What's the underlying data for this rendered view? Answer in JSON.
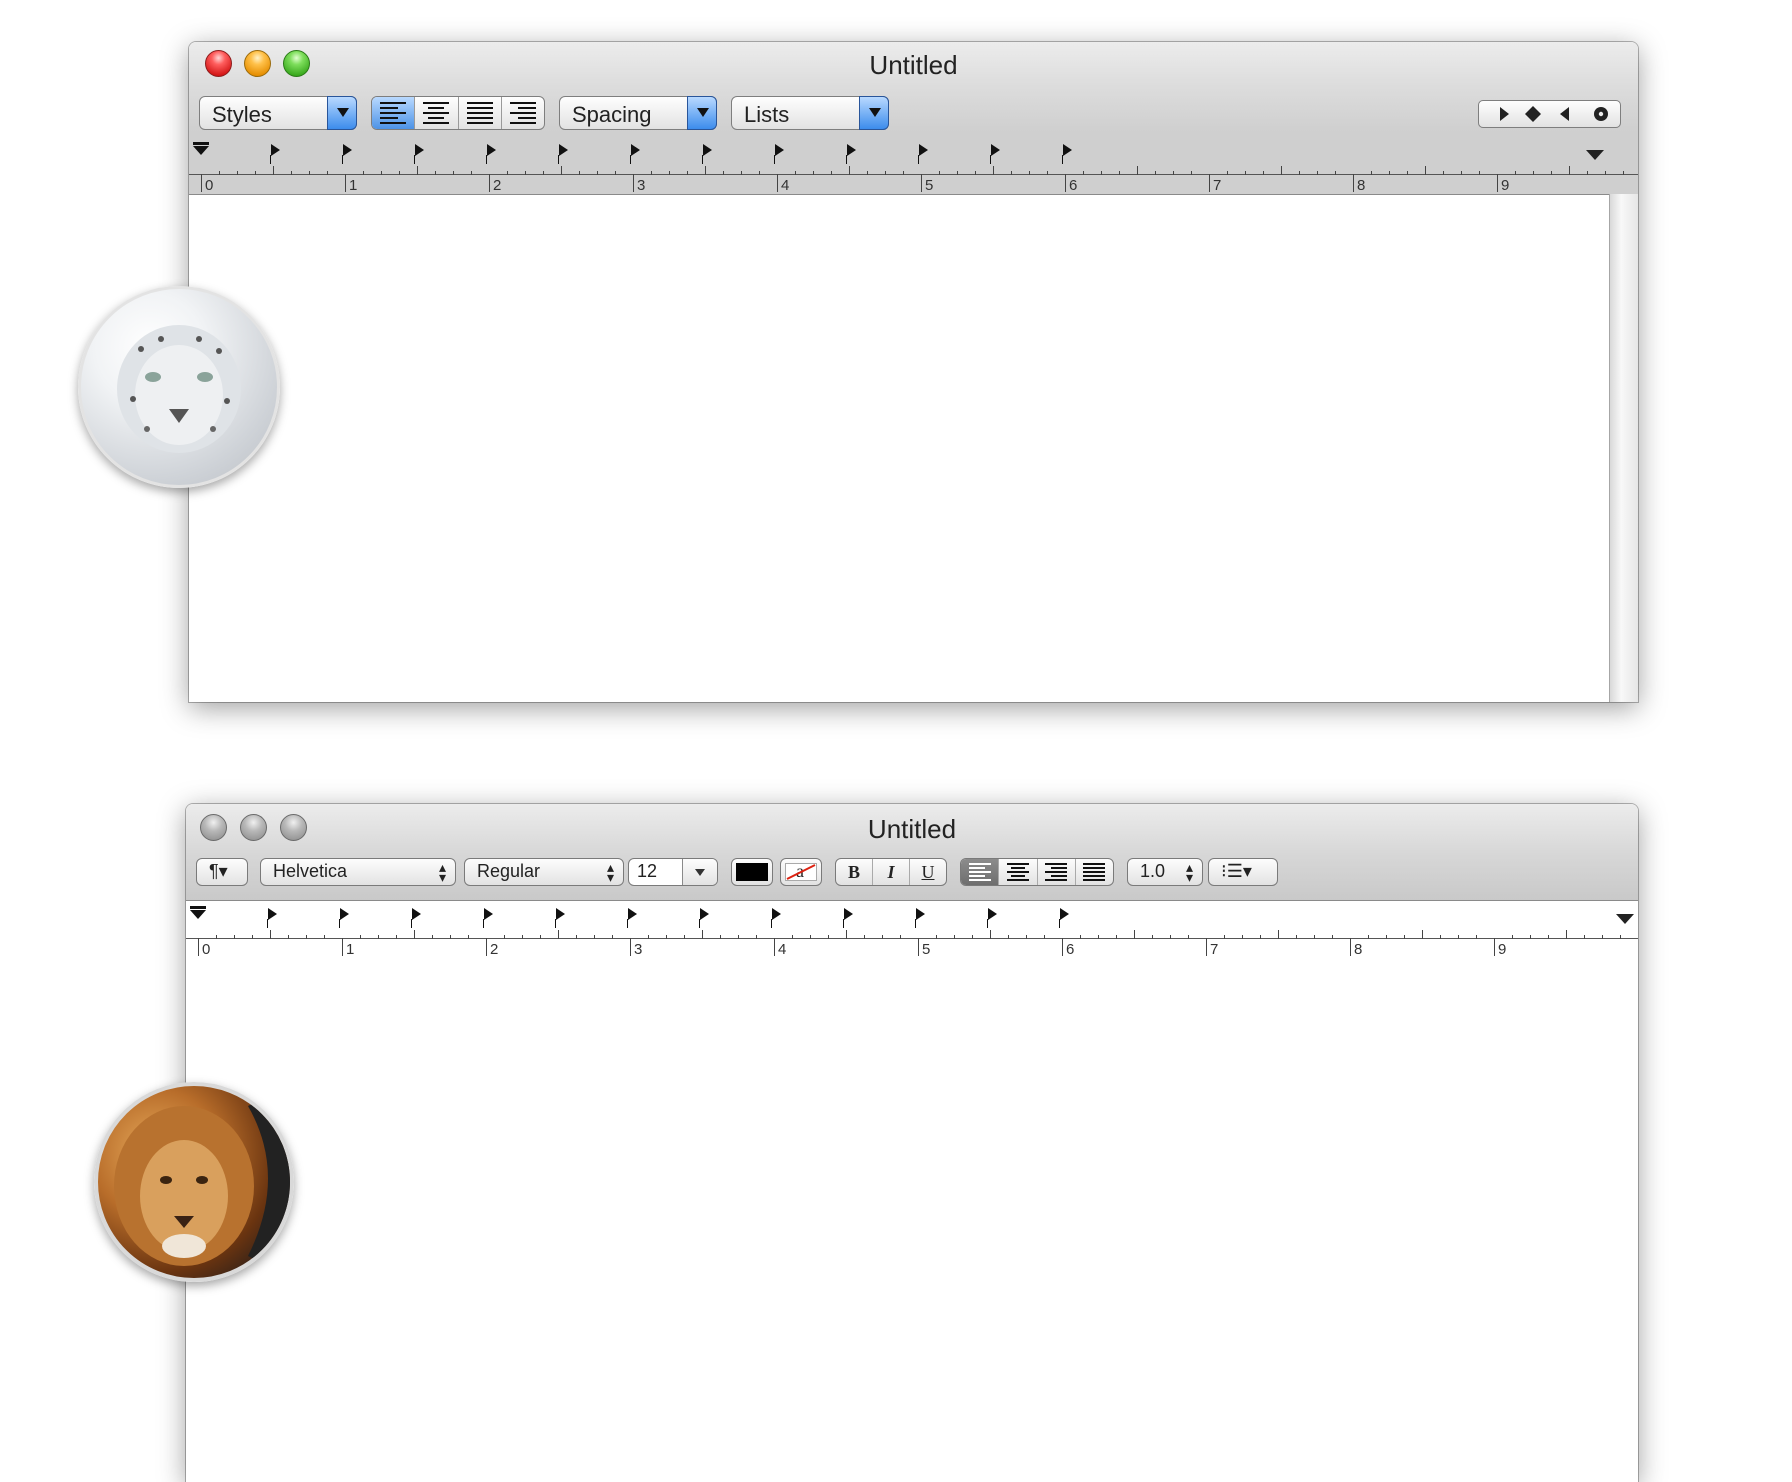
{
  "window1": {
    "title": "Untitled",
    "styles_label": "Styles",
    "spacing_label": "Spacing",
    "lists_label": "Lists",
    "alignment_options": [
      "align-left-icon",
      "align-center-icon",
      "align-justify-icon",
      "align-right-icon"
    ],
    "selected_alignment": "align-left",
    "tab_stop_controls": [
      "left-tab-icon",
      "center-tab-icon",
      "right-tab-icon",
      "decimal-tab-icon"
    ],
    "ruler_numbers": [
      "0",
      "1",
      "2",
      "3",
      "4",
      "5",
      "6",
      "7",
      "8",
      "9"
    ]
  },
  "window2": {
    "title": "Untitled",
    "paragraph_styles_label": "¶▾",
    "font_family": "Helvetica",
    "font_style": "Regular",
    "font_size": "12",
    "text_color": "#000000",
    "highlight_label": "a",
    "bold_label": "B",
    "italic_label": "I",
    "underline_label": "U",
    "line_spacing": "1.0",
    "lists_label": "⁝☰▾",
    "ruler_numbers": [
      "0",
      "1",
      "2",
      "3",
      "4",
      "5",
      "6",
      "7",
      "8",
      "9"
    ]
  },
  "badges": {
    "top": "snow-leopard-icon",
    "bottom": "lion-icon"
  }
}
